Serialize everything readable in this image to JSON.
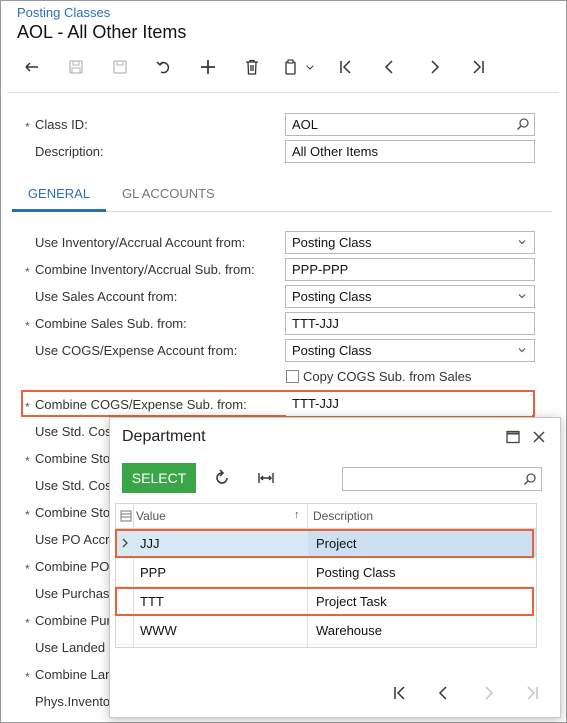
{
  "breadcrumb": "Posting Classes",
  "title": "AOL - All Other Items",
  "toolbar_icons": [
    "back-icon",
    "save-close-icon",
    "save-icon",
    "undo-icon",
    "add-icon",
    "delete-icon",
    "copy-paste-icon",
    "first-icon",
    "prev-icon",
    "next-icon",
    "last-icon"
  ],
  "header_fields": {
    "class_id_label": "Class ID:",
    "class_id_value": "AOL",
    "description_label": "Description:",
    "description_value": "All Other Items"
  },
  "tabs": [
    "GENERAL",
    "GL ACCOUNTS"
  ],
  "form": {
    "inv_account_label": "Use Inventory/Accrual Account from:",
    "inv_account_value": "Posting Class",
    "inv_sub_label": "Combine Inventory/Accrual Sub. from:",
    "inv_sub_value": "PPP-PPP",
    "sales_account_label": "Use Sales Account from:",
    "sales_account_value": "Posting Class",
    "sales_sub_label": "Combine Sales Sub. from:",
    "sales_sub_value": "TTT-JJJ",
    "cogs_account_label": "Use COGS/Expense Account from:",
    "cogs_account_value": "Posting Class",
    "copy_cogs_label": "Copy COGS Sub. from Sales",
    "cogs_sub_label": "Combine COGS/Expense Sub. from:",
    "cogs_sub_value": "TTT-JJJ",
    "truncated_labels": [
      {
        "text": "Use Std. Cos",
        "req": false
      },
      {
        "text": "Combine Sto",
        "req": true
      },
      {
        "text": "Use Std. Cos",
        "req": false
      },
      {
        "text": "Combine Sto",
        "req": true
      },
      {
        "text": "Use PO Accr",
        "req": false
      },
      {
        "text": "Combine PO",
        "req": true
      },
      {
        "text": "Use Purchas",
        "req": false
      },
      {
        "text": "Combine Pur",
        "req": true
      },
      {
        "text": "Use Landed",
        "req": false
      },
      {
        "text": "Combine Lan",
        "req": true
      },
      {
        "text": "Phys.Invento",
        "req": false
      }
    ]
  },
  "popup": {
    "title": "Department",
    "select_label": "SELECT",
    "columns": [
      "Value",
      "Description"
    ],
    "rows": [
      {
        "value": "JJJ",
        "description": "Project"
      },
      {
        "value": "PPP",
        "description": "Posting Class"
      },
      {
        "value": "TTT",
        "description": "Project Task"
      },
      {
        "value": "WWW",
        "description": "Warehouse"
      }
    ]
  },
  "colors": {
    "accent": "#2a6ebb",
    "highlight": "#e8623a",
    "select_button": "#3aa647",
    "selected_row": "#d8e8f5"
  }
}
